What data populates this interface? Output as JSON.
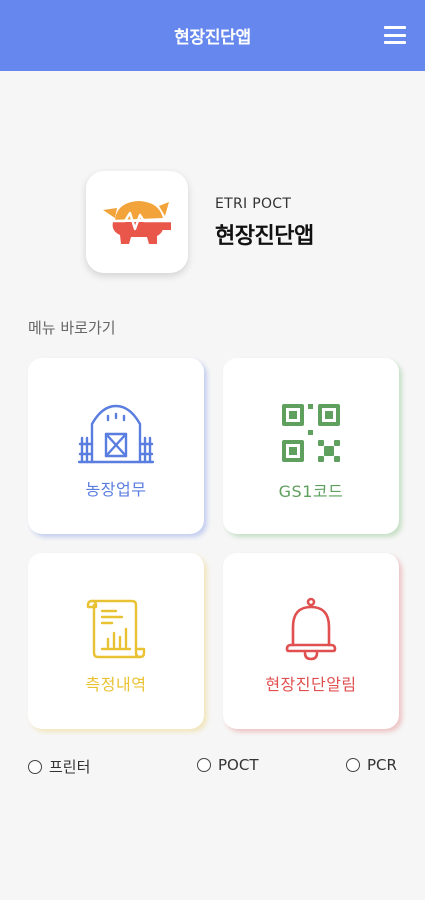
{
  "appbar": {
    "title": "현장진단앱",
    "menu_icon": "hamburger-menu-icon"
  },
  "brand": {
    "subtitle": "ETRI POCT",
    "title": "현장진단앱",
    "logo_icon": "pig-heartbeat-logo"
  },
  "section": {
    "label": "메뉴 바로가기"
  },
  "tiles": [
    {
      "label": "농장업무",
      "icon": "barn-icon",
      "color": "#5a7de0"
    },
    {
      "label": "GS1코드",
      "icon": "qr-code-icon",
      "color": "#5fa05f"
    },
    {
      "label": "측정내역",
      "icon": "receipt-chart-icon",
      "color": "#e9c233"
    },
    {
      "label": "현장진단알림",
      "icon": "bell-icon",
      "color": "#e05050"
    }
  ],
  "status": [
    {
      "label": "프린터"
    },
    {
      "label": "POCT"
    },
    {
      "label": "PCR"
    }
  ]
}
